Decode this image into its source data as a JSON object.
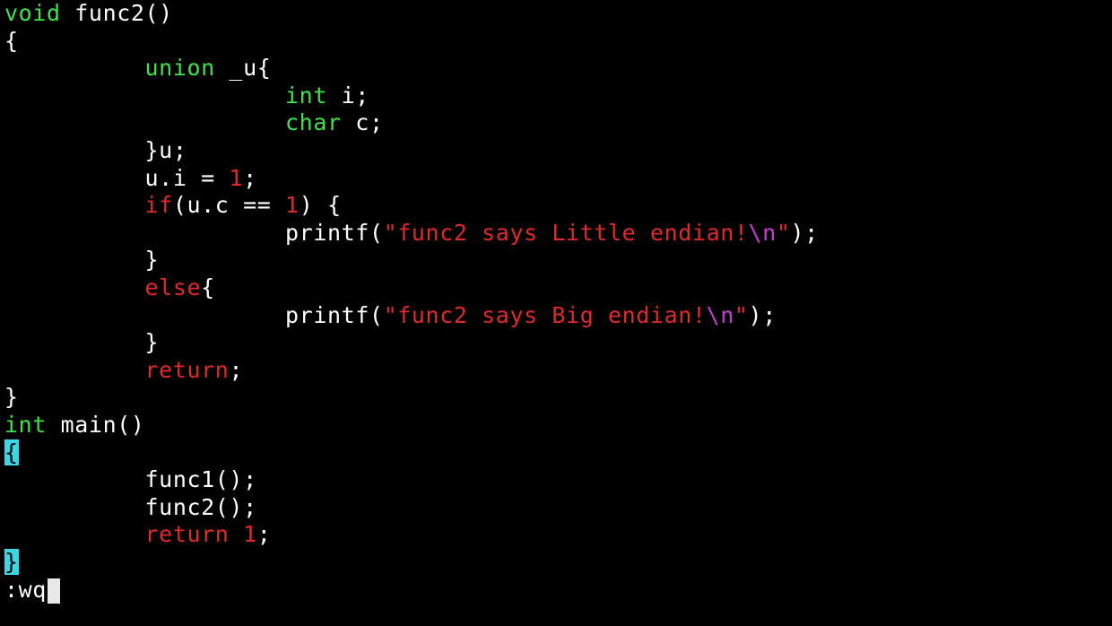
{
  "colors": {
    "background": "#000000",
    "default": "#ffffff",
    "type": "#3ee34a",
    "keyword": "#e02a2a",
    "number": "#e02a2a",
    "string": "#e02a2a",
    "escape": "#c43ed0",
    "match_highlight": "#3ad7e6"
  },
  "lines": [
    [
      {
        "t": "void",
        "c": "type"
      },
      {
        "t": " func2()",
        "c": "default"
      }
    ],
    [
      {
        "t": "{",
        "c": "default"
      }
    ],
    [
      {
        "t": "          ",
        "c": "default"
      },
      {
        "t": "union",
        "c": "type"
      },
      {
        "t": " _u{",
        "c": "default"
      }
    ],
    [
      {
        "t": "                    ",
        "c": "default"
      },
      {
        "t": "int",
        "c": "type"
      },
      {
        "t": " i;",
        "c": "default"
      }
    ],
    [
      {
        "t": "                    ",
        "c": "default"
      },
      {
        "t": "char",
        "c": "type"
      },
      {
        "t": " c;",
        "c": "default"
      }
    ],
    [
      {
        "t": "          }u;",
        "c": "default"
      }
    ],
    [
      {
        "t": "          u.i = ",
        "c": "default"
      },
      {
        "t": "1",
        "c": "number"
      },
      {
        "t": ";",
        "c": "default"
      }
    ],
    [
      {
        "t": "          ",
        "c": "default"
      },
      {
        "t": "if",
        "c": "keyword"
      },
      {
        "t": "(u.c == ",
        "c": "default"
      },
      {
        "t": "1",
        "c": "number"
      },
      {
        "t": ") {",
        "c": "default"
      }
    ],
    [
      {
        "t": "                    printf(",
        "c": "default"
      },
      {
        "t": "\"func2 says Little endian!",
        "c": "string"
      },
      {
        "t": "\\n",
        "c": "escape"
      },
      {
        "t": "\"",
        "c": "string"
      },
      {
        "t": ");",
        "c": "default"
      }
    ],
    [
      {
        "t": "          }",
        "c": "default"
      }
    ],
    [
      {
        "t": "          ",
        "c": "default"
      },
      {
        "t": "else",
        "c": "keyword"
      },
      {
        "t": "{",
        "c": "default"
      }
    ],
    [
      {
        "t": "                    printf(",
        "c": "default"
      },
      {
        "t": "\"func2 says Big endian!",
        "c": "string"
      },
      {
        "t": "\\n",
        "c": "escape"
      },
      {
        "t": "\"",
        "c": "string"
      },
      {
        "t": ");",
        "c": "default"
      }
    ],
    [
      {
        "t": "          }",
        "c": "default"
      }
    ],
    [
      {
        "t": "          ",
        "c": "default"
      },
      {
        "t": "return",
        "c": "keyword"
      },
      {
        "t": ";",
        "c": "default"
      }
    ],
    [
      {
        "t": "}",
        "c": "default"
      }
    ],
    [
      {
        "t": "int",
        "c": "type"
      },
      {
        "t": " main()",
        "c": "default"
      }
    ],
    [
      {
        "t": "{",
        "c": "bracket-hl"
      }
    ],
    [
      {
        "t": "          func1();",
        "c": "default"
      }
    ],
    [
      {
        "t": "          func2();",
        "c": "default"
      }
    ],
    [
      {
        "t": "          ",
        "c": "default"
      },
      {
        "t": "return",
        "c": "keyword"
      },
      {
        "t": " ",
        "c": "default"
      },
      {
        "t": "1",
        "c": "number"
      },
      {
        "t": ";",
        "c": "default"
      }
    ],
    [
      {
        "t": "}",
        "c": "bracket-hl"
      }
    ]
  ],
  "command_line": {
    "text": ":wq"
  }
}
